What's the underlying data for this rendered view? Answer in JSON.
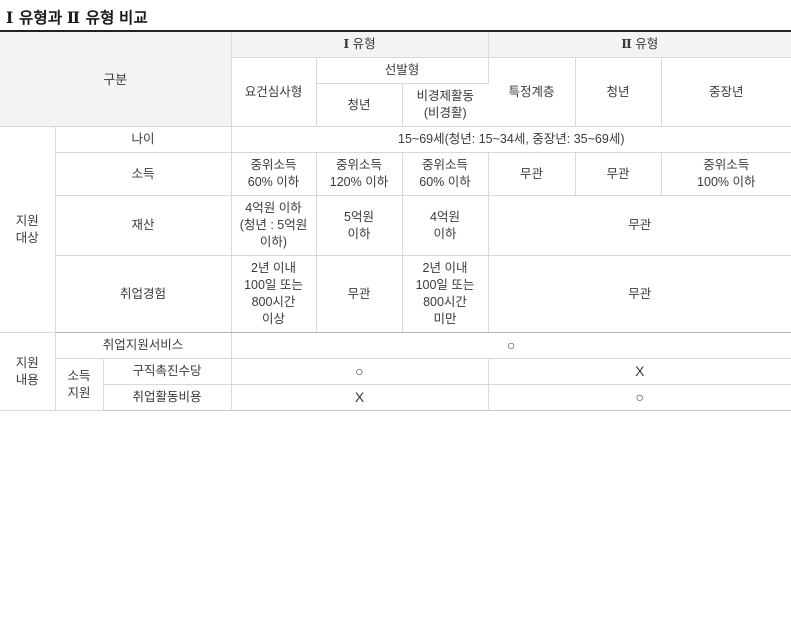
{
  "page": {
    "title_parts": [
      "Ⅰ",
      " 유형과 ",
      "Ⅱ",
      " 유형 비교"
    ],
    "title_text": "Ⅰ 유형과 Ⅱ 유형 비교"
  },
  "table": {
    "corner_label": "구분",
    "type_groups": [
      {
        "label_numeral": "Ⅰ",
        "label_suffix": " 유형"
      },
      {
        "label_numeral": "Ⅱ",
        "label_suffix": " 유형"
      }
    ],
    "subgroup_label": "선발형",
    "columns": [
      {
        "key": "yogeon",
        "label": "요건심사형"
      },
      {
        "key": "cheongnyeon1",
        "label": "청년"
      },
      {
        "key": "bigyeongje",
        "label": "비경제활동\n(비경활)",
        "line1": "비경제활동",
        "line2": "(비경활)"
      },
      {
        "key": "teukjeong",
        "label": "특정계층"
      },
      {
        "key": "cheongnyeon2",
        "label": "청년"
      },
      {
        "key": "jungjangnyeon",
        "label": "중장년"
      }
    ],
    "sections": [
      {
        "key": "support_target",
        "label": "지원\n대상",
        "label_line1": "지원",
        "label_line2": "대상",
        "rows": [
          {
            "key": "age",
            "label": "나이",
            "span_all": true,
            "value": "15~69세(청년: 15~34세, 중장년: 35~69세)"
          },
          {
            "key": "income",
            "label": "소득",
            "cells": [
              {
                "line1": "중위소득",
                "line2": "60% 이하"
              },
              {
                "line1": "중위소득",
                "line2": "120% 이하"
              },
              {
                "line1": "중위소득",
                "line2": "60% 이하"
              },
              {
                "line1": "무관",
                "line2": ""
              },
              {
                "line1": "무관",
                "line2": ""
              },
              {
                "line1": "중위소득",
                "line2": "100% 이하"
              }
            ]
          },
          {
            "key": "assets",
            "label": "재산",
            "cells": [
              {
                "line1": "4억원 이하",
                "line2": "(청년 : 5억원",
                "line3": "이하)"
              },
              {
                "line1": "5억원",
                "line2": "이하"
              },
              {
                "line1": "4억원",
                "line2": "이하"
              },
              {
                "line1": "무관",
                "colspan": 3
              }
            ]
          },
          {
            "key": "work_experience",
            "label": "취업경험",
            "cells": [
              {
                "line1": "2년 이내",
                "line2": "100일 또는",
                "line3": "800시간",
                "line4": "이상"
              },
              {
                "line1": "무관"
              },
              {
                "line1": "2년 이내",
                "line2": "100일 또는",
                "line3": "800시간",
                "line4": "미만"
              },
              {
                "line1": "무관",
                "colspan": 3
              }
            ]
          }
        ]
      },
      {
        "key": "support_content",
        "label": "지원\n내용",
        "label_line1": "지원",
        "label_line2": "내용",
        "rows": [
          {
            "key": "employment_service",
            "label": "취업지원서비스",
            "span_all": true,
            "value": "○"
          },
          {
            "key": "income_support",
            "group_label_line1": "소득",
            "group_label_line2": "지원",
            "subrows": [
              {
                "key": "job_seeking_allowance",
                "label": "구직촉진수당",
                "type1_value": "○",
                "type2_value": "X"
              },
              {
                "key": "job_activity_expense",
                "label": "취업활동비용",
                "type1_value": "X",
                "type2_value": "○"
              }
            ]
          }
        ]
      }
    ]
  },
  "colors": {
    "header_shade": "#f4f3f4",
    "border": "#d9d9d9",
    "top_border": "#222222",
    "text": "#3b3b3b"
  }
}
